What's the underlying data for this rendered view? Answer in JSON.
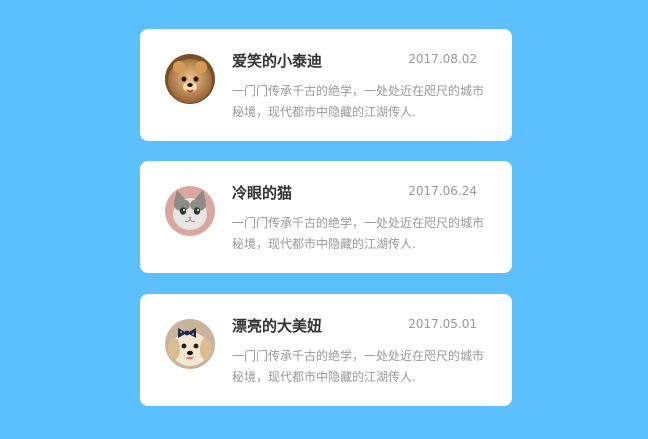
{
  "posts": [
    {
      "name": "爱笑的小泰迪",
      "date": "2017.08.02",
      "description": "一门门传承千古的绝学，一处处近在咫尺的城市秘境，现代都市中隐藏的江湖传人.",
      "avatar": "pomeranian-dog-photo"
    },
    {
      "name": "冷眼的猫",
      "date": "2017.06.24",
      "description": "一门门传承千古的绝学，一处处近在咫尺的城市秘境，现代都市中隐藏的江湖传人.",
      "avatar": "grey-white-cat-photo"
    },
    {
      "name": "漂亮的大美妞",
      "date": "2017.05.01",
      "description": "一门门传承千古的绝学，一处处近在咫尺的城市秘境，现代都市中隐藏的江湖传人.",
      "avatar": "golden-puppy-with-bow-photo"
    }
  ],
  "colors": {
    "background": "#5bc0fb",
    "card": "#ffffff",
    "name_text": "#333333",
    "meta_text": "#999999"
  }
}
